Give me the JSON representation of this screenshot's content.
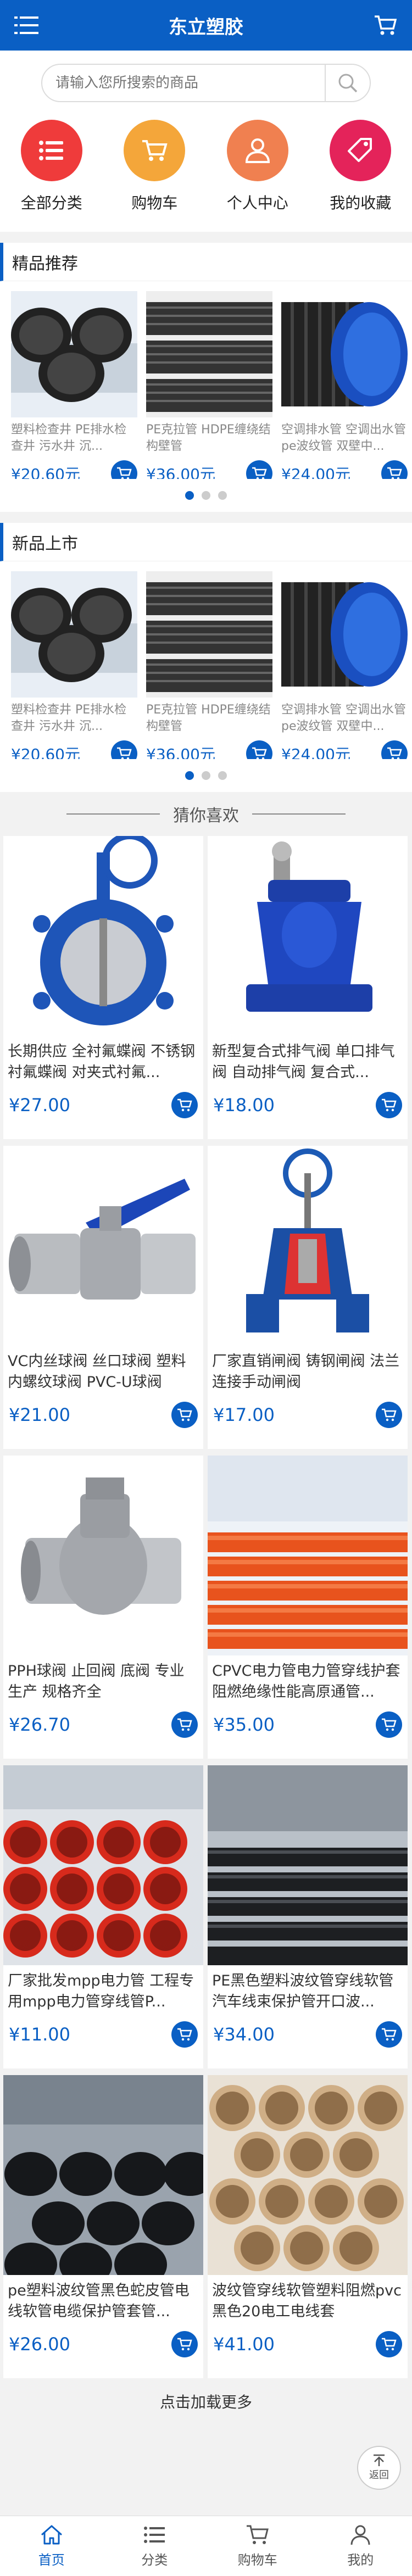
{
  "header": {
    "title": "东立塑胶"
  },
  "search": {
    "placeholder": "请输入您所搜索的商品"
  },
  "quick": [
    {
      "label": "全部分类",
      "color": "#ef3b3b",
      "icon": "list-icon"
    },
    {
      "label": "购物车",
      "color": "#f4a63a",
      "icon": "cart-icon"
    },
    {
      "label": "个人中心",
      "color": "#f08050",
      "icon": "person-icon"
    },
    {
      "label": "我的收藏",
      "color": "#e4235a",
      "icon": "tag-icon"
    }
  ],
  "featured": {
    "title": "精品推荐",
    "items": [
      {
        "name": "塑料检查井 PE排水检查井 污水井 沉...",
        "price": "¥20.60元"
      },
      {
        "name": "PE克拉管 HDPE缠绕结构壁管",
        "price": "¥36.00元"
      },
      {
        "name": "空调排水管 空调出水管pe波纹管 双壁中...",
        "price": "¥24.00元"
      }
    ]
  },
  "newArrivals": {
    "title": "新品上市",
    "items": [
      {
        "name": "塑料检查井 PE排水检查井 污水井 沉...",
        "price": "¥20.60元"
      },
      {
        "name": "PE克拉管 HDPE缠绕结构壁管",
        "price": "¥36.00元"
      },
      {
        "name": "空调排水管 空调出水管pe波纹管 双壁中...",
        "price": "¥24.00元"
      }
    ]
  },
  "guess": {
    "title": "猜你喜欢",
    "items": [
      {
        "name": "长期供应 全衬氟蝶阀 不锈钢衬氟蝶阀 对夹式衬氟...",
        "price": "¥27.00",
        "img": "butterfly"
      },
      {
        "name": "新型复合式排气阀 单口排气阀 自动排气阀 复合式...",
        "price": "¥18.00",
        "img": "airvalve"
      },
      {
        "name": "VC内丝球阀 丝口球阀 塑料内螺纹球阀 PVC-U球阀",
        "price": "¥21.00",
        "img": "ballvalve"
      },
      {
        "name": "厂家直销闸阀 铸钢闸阀 法兰连接手动闸阀",
        "price": "¥17.00",
        "img": "gatevalve"
      },
      {
        "name": "PPH球阀 止回阀 底阀 专业生产 规格齐全",
        "price": "¥26.70",
        "img": "checkvalve"
      },
      {
        "name": "CPVC电力管电力管穿线护套阻燃绝缘性能高原通管...",
        "price": "¥35.00",
        "img": "orangepipe"
      },
      {
        "name": "厂家批发mpp电力管 工程专用mpp电力管穿线管P...",
        "price": "¥11.00",
        "img": "redpipe"
      },
      {
        "name": "PE黑色塑料波纹管穿线软管汽车线束保护管开口波...",
        "price": "¥34.00",
        "img": "blackpipe"
      },
      {
        "name": "pe塑料波纹管黑色蛇皮管电线软管电缆保护管套管...",
        "price": "¥26.00",
        "img": "blackpipe2"
      },
      {
        "name": "波纹管穿线软管塑料阻燃pvc黑色20电工电线套",
        "price": "¥41.00",
        "img": "tanpipe"
      }
    ]
  },
  "loadMore": "点击加载更多",
  "toTop": "返回",
  "tabs": [
    {
      "label": "首页",
      "icon": "home-icon"
    },
    {
      "label": "分类",
      "icon": "category-icon"
    },
    {
      "label": "购物车",
      "icon": "cart-icon"
    },
    {
      "label": "我的",
      "icon": "user-icon"
    }
  ],
  "colors": {
    "brand": "#0a5fc4"
  }
}
